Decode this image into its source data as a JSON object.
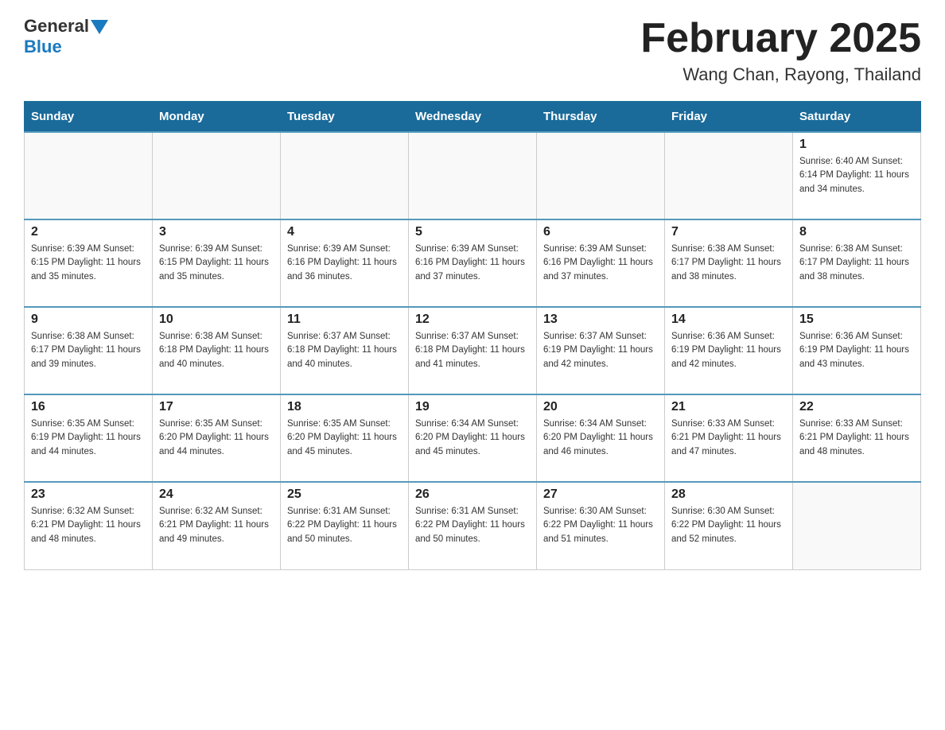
{
  "header": {
    "logo_general": "General",
    "logo_blue": "Blue",
    "month_title": "February 2025",
    "location": "Wang Chan, Rayong, Thailand"
  },
  "weekdays": [
    "Sunday",
    "Monday",
    "Tuesday",
    "Wednesday",
    "Thursday",
    "Friday",
    "Saturday"
  ],
  "weeks": [
    [
      {
        "day": "",
        "info": ""
      },
      {
        "day": "",
        "info": ""
      },
      {
        "day": "",
        "info": ""
      },
      {
        "day": "",
        "info": ""
      },
      {
        "day": "",
        "info": ""
      },
      {
        "day": "",
        "info": ""
      },
      {
        "day": "1",
        "info": "Sunrise: 6:40 AM\nSunset: 6:14 PM\nDaylight: 11 hours\nand 34 minutes."
      }
    ],
    [
      {
        "day": "2",
        "info": "Sunrise: 6:39 AM\nSunset: 6:15 PM\nDaylight: 11 hours\nand 35 minutes."
      },
      {
        "day": "3",
        "info": "Sunrise: 6:39 AM\nSunset: 6:15 PM\nDaylight: 11 hours\nand 35 minutes."
      },
      {
        "day": "4",
        "info": "Sunrise: 6:39 AM\nSunset: 6:16 PM\nDaylight: 11 hours\nand 36 minutes."
      },
      {
        "day": "5",
        "info": "Sunrise: 6:39 AM\nSunset: 6:16 PM\nDaylight: 11 hours\nand 37 minutes."
      },
      {
        "day": "6",
        "info": "Sunrise: 6:39 AM\nSunset: 6:16 PM\nDaylight: 11 hours\nand 37 minutes."
      },
      {
        "day": "7",
        "info": "Sunrise: 6:38 AM\nSunset: 6:17 PM\nDaylight: 11 hours\nand 38 minutes."
      },
      {
        "day": "8",
        "info": "Sunrise: 6:38 AM\nSunset: 6:17 PM\nDaylight: 11 hours\nand 38 minutes."
      }
    ],
    [
      {
        "day": "9",
        "info": "Sunrise: 6:38 AM\nSunset: 6:17 PM\nDaylight: 11 hours\nand 39 minutes."
      },
      {
        "day": "10",
        "info": "Sunrise: 6:38 AM\nSunset: 6:18 PM\nDaylight: 11 hours\nand 40 minutes."
      },
      {
        "day": "11",
        "info": "Sunrise: 6:37 AM\nSunset: 6:18 PM\nDaylight: 11 hours\nand 40 minutes."
      },
      {
        "day": "12",
        "info": "Sunrise: 6:37 AM\nSunset: 6:18 PM\nDaylight: 11 hours\nand 41 minutes."
      },
      {
        "day": "13",
        "info": "Sunrise: 6:37 AM\nSunset: 6:19 PM\nDaylight: 11 hours\nand 42 minutes."
      },
      {
        "day": "14",
        "info": "Sunrise: 6:36 AM\nSunset: 6:19 PM\nDaylight: 11 hours\nand 42 minutes."
      },
      {
        "day": "15",
        "info": "Sunrise: 6:36 AM\nSunset: 6:19 PM\nDaylight: 11 hours\nand 43 minutes."
      }
    ],
    [
      {
        "day": "16",
        "info": "Sunrise: 6:35 AM\nSunset: 6:19 PM\nDaylight: 11 hours\nand 44 minutes."
      },
      {
        "day": "17",
        "info": "Sunrise: 6:35 AM\nSunset: 6:20 PM\nDaylight: 11 hours\nand 44 minutes."
      },
      {
        "day": "18",
        "info": "Sunrise: 6:35 AM\nSunset: 6:20 PM\nDaylight: 11 hours\nand 45 minutes."
      },
      {
        "day": "19",
        "info": "Sunrise: 6:34 AM\nSunset: 6:20 PM\nDaylight: 11 hours\nand 45 minutes."
      },
      {
        "day": "20",
        "info": "Sunrise: 6:34 AM\nSunset: 6:20 PM\nDaylight: 11 hours\nand 46 minutes."
      },
      {
        "day": "21",
        "info": "Sunrise: 6:33 AM\nSunset: 6:21 PM\nDaylight: 11 hours\nand 47 minutes."
      },
      {
        "day": "22",
        "info": "Sunrise: 6:33 AM\nSunset: 6:21 PM\nDaylight: 11 hours\nand 48 minutes."
      }
    ],
    [
      {
        "day": "23",
        "info": "Sunrise: 6:32 AM\nSunset: 6:21 PM\nDaylight: 11 hours\nand 48 minutes."
      },
      {
        "day": "24",
        "info": "Sunrise: 6:32 AM\nSunset: 6:21 PM\nDaylight: 11 hours\nand 49 minutes."
      },
      {
        "day": "25",
        "info": "Sunrise: 6:31 AM\nSunset: 6:22 PM\nDaylight: 11 hours\nand 50 minutes."
      },
      {
        "day": "26",
        "info": "Sunrise: 6:31 AM\nSunset: 6:22 PM\nDaylight: 11 hours\nand 50 minutes."
      },
      {
        "day": "27",
        "info": "Sunrise: 6:30 AM\nSunset: 6:22 PM\nDaylight: 11 hours\nand 51 minutes."
      },
      {
        "day": "28",
        "info": "Sunrise: 6:30 AM\nSunset: 6:22 PM\nDaylight: 11 hours\nand 52 minutes."
      },
      {
        "day": "",
        "info": ""
      }
    ]
  ]
}
